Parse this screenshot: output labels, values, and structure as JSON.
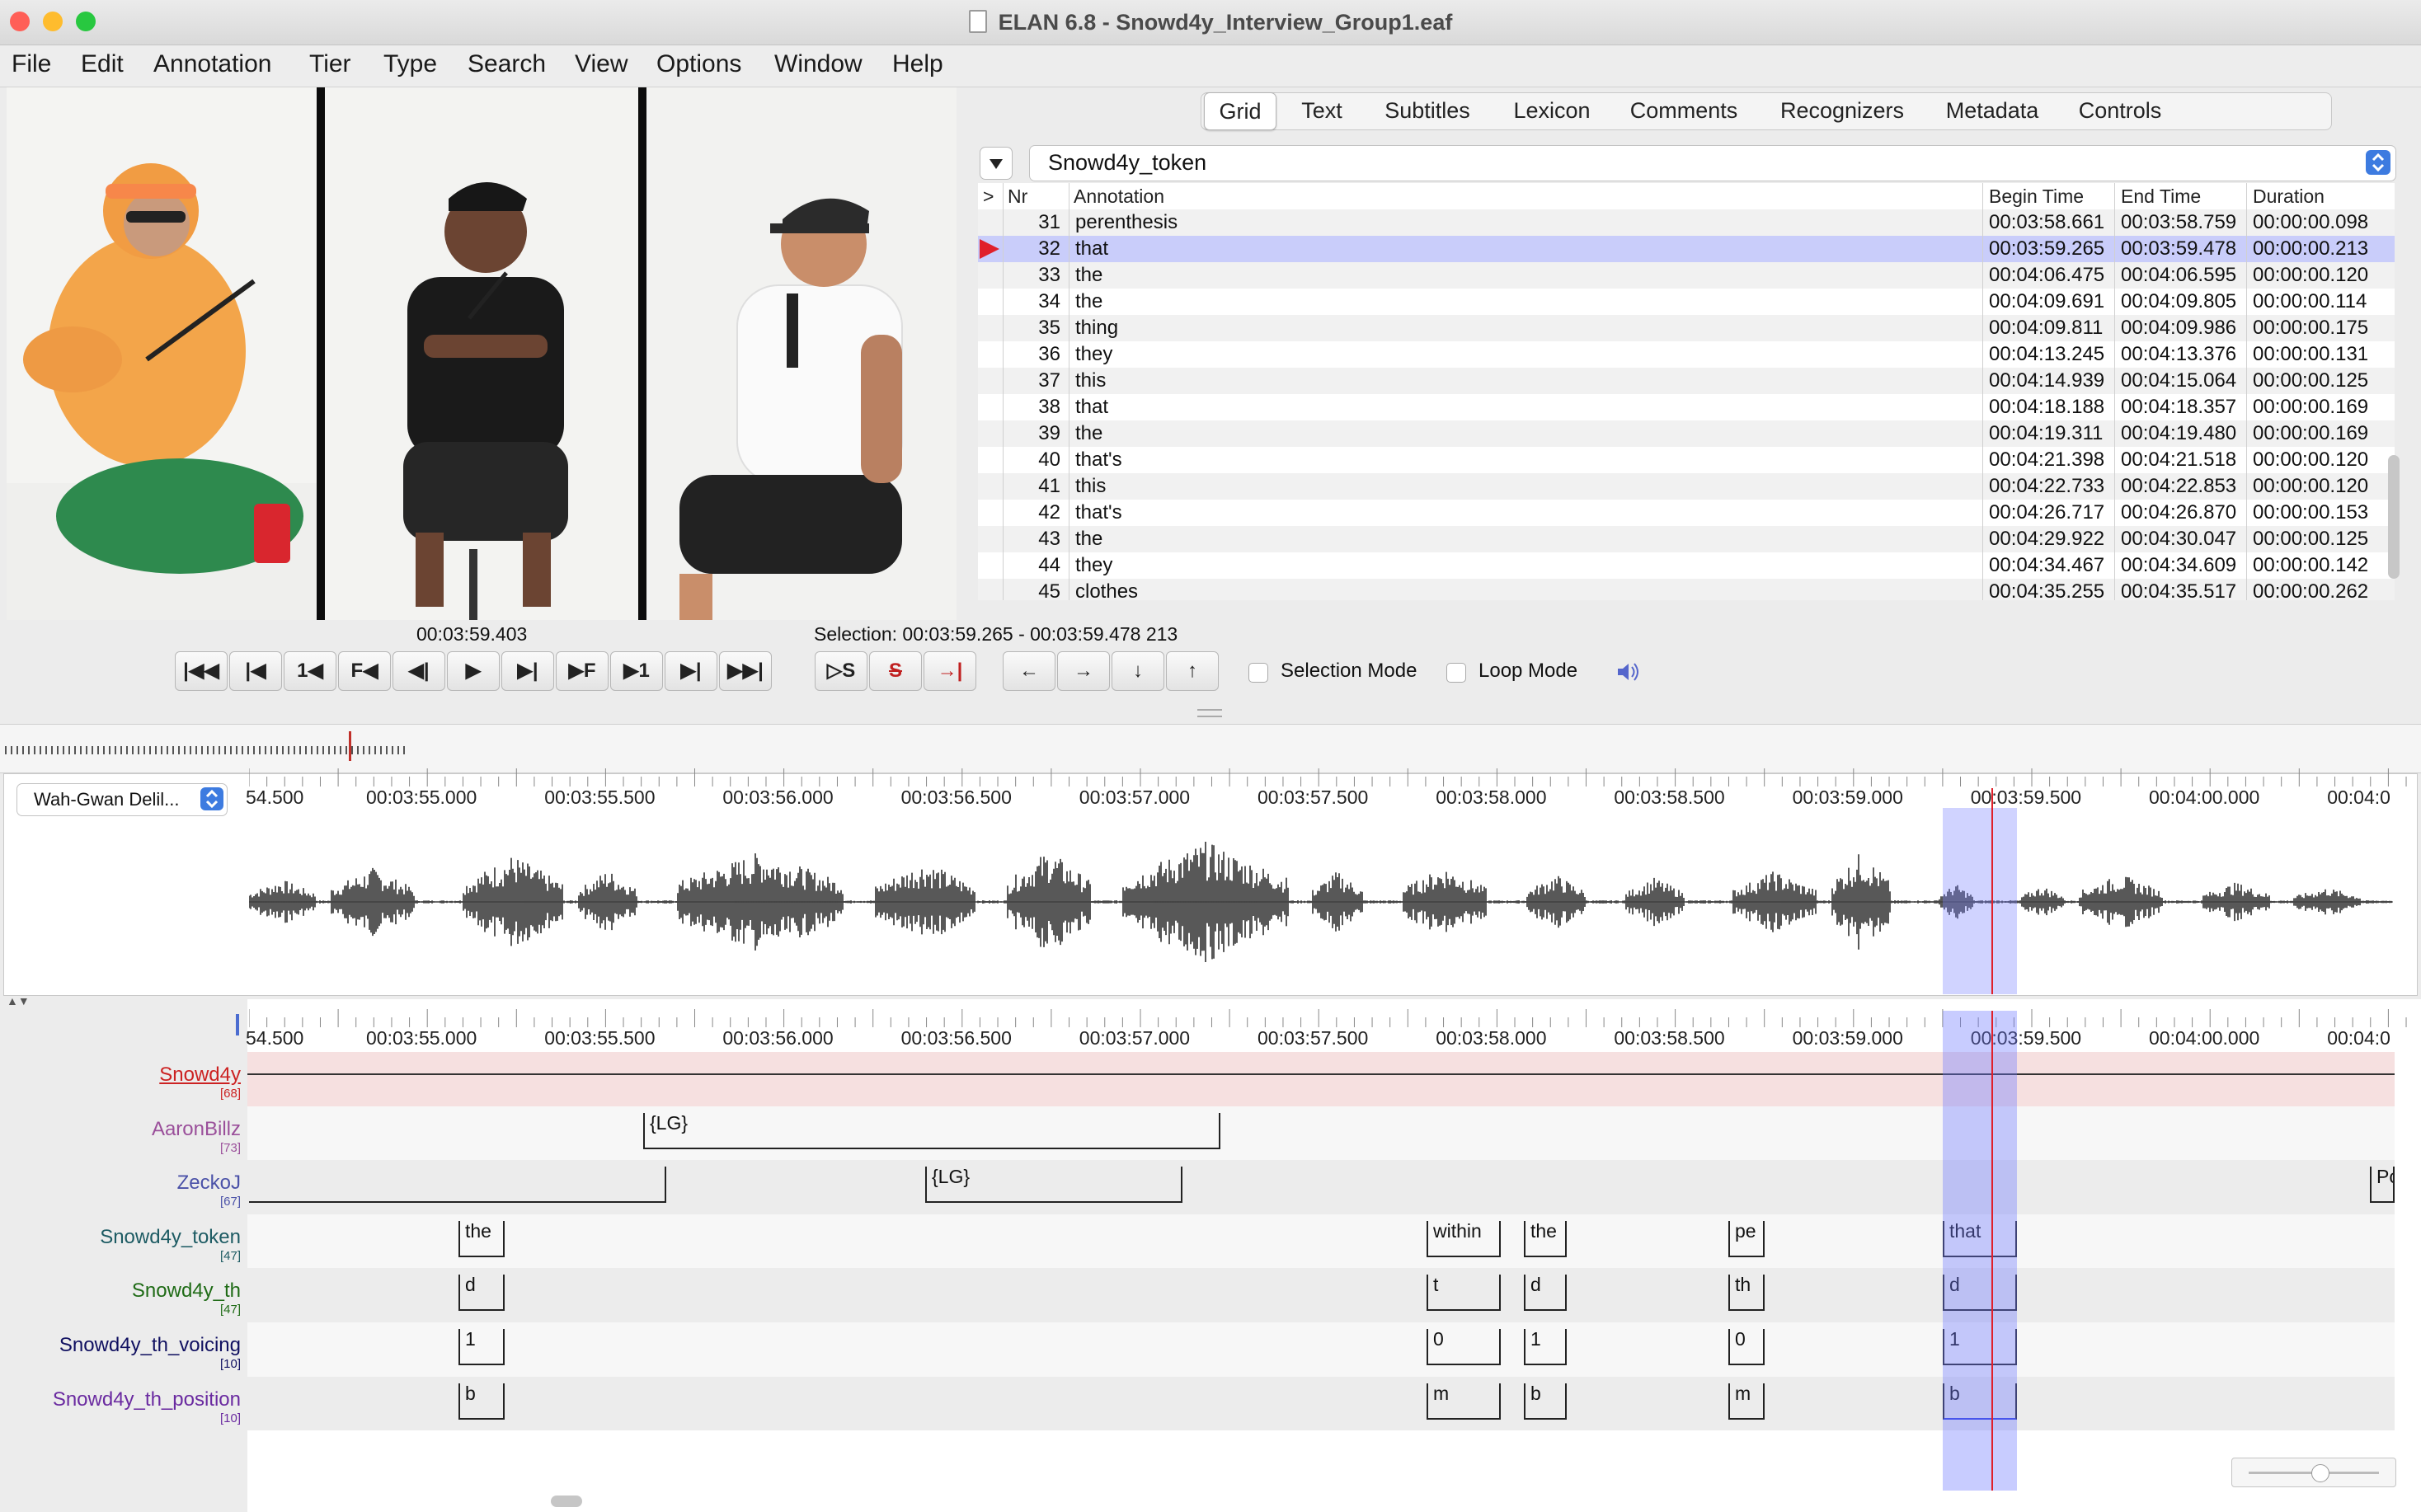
{
  "window": {
    "title": "ELAN 6.8 - Snowd4y_Interview_Group1.eaf",
    "traffic_lights": {
      "close": "#ff5f57",
      "minimize": "#febc2e",
      "zoom": "#28c840"
    }
  },
  "menubar": [
    "File",
    "Edit",
    "Annotation",
    "Tier",
    "Type",
    "Search",
    "View",
    "Options",
    "Window",
    "Help"
  ],
  "tabs": [
    "Grid",
    "Text",
    "Subtitles",
    "Lexicon",
    "Comments",
    "Recognizers",
    "Metadata",
    "Controls"
  ],
  "active_tab": "Grid",
  "grid": {
    "tier_selector": "Snowd4y_token",
    "columns": [
      ">",
      "Nr",
      "Annotation",
      "Begin Time",
      "End Time",
      "Duration"
    ],
    "selected_nr": 32,
    "rows": [
      {
        "nr": "31",
        "annotation": "perenthesis",
        "begin": "00:03:58.661",
        "end": "00:03:58.759",
        "duration": "00:00:00.098"
      },
      {
        "nr": "32",
        "annotation": "that",
        "begin": "00:03:59.265",
        "end": "00:03:59.478",
        "duration": "00:00:00.213"
      },
      {
        "nr": "33",
        "annotation": "the",
        "begin": "00:04:06.475",
        "end": "00:04:06.595",
        "duration": "00:00:00.120"
      },
      {
        "nr": "34",
        "annotation": "the",
        "begin": "00:04:09.691",
        "end": "00:04:09.805",
        "duration": "00:00:00.114"
      },
      {
        "nr": "35",
        "annotation": "thing",
        "begin": "00:04:09.811",
        "end": "00:04:09.986",
        "duration": "00:00:00.175"
      },
      {
        "nr": "36",
        "annotation": "they",
        "begin": "00:04:13.245",
        "end": "00:04:13.376",
        "duration": "00:00:00.131"
      },
      {
        "nr": "37",
        "annotation": "this",
        "begin": "00:04:14.939",
        "end": "00:04:15.064",
        "duration": "00:00:00.125"
      },
      {
        "nr": "38",
        "annotation": "that",
        "begin": "00:04:18.188",
        "end": "00:04:18.357",
        "duration": "00:00:00.169"
      },
      {
        "nr": "39",
        "annotation": "the",
        "begin": "00:04:19.311",
        "end": "00:04:19.480",
        "duration": "00:00:00.169"
      },
      {
        "nr": "40",
        "annotation": "that's",
        "begin": "00:04:21.398",
        "end": "00:04:21.518",
        "duration": "00:00:00.120"
      },
      {
        "nr": "41",
        "annotation": "this",
        "begin": "00:04:22.733",
        "end": "00:04:22.853",
        "duration": "00:00:00.120"
      },
      {
        "nr": "42",
        "annotation": "that's",
        "begin": "00:04:26.717",
        "end": "00:04:26.870",
        "duration": "00:00:00.153"
      },
      {
        "nr": "43",
        "annotation": "the",
        "begin": "00:04:29.922",
        "end": "00:04:30.047",
        "duration": "00:00:00.125"
      },
      {
        "nr": "44",
        "annotation": "they",
        "begin": "00:04:34.467",
        "end": "00:04:34.609",
        "duration": "00:00:00.142"
      },
      {
        "nr": "45",
        "annotation": "clothes",
        "begin": "00:04:35.255",
        "end": "00:04:35.517",
        "duration": "00:00:00.262"
      }
    ]
  },
  "media_time": "00:03:59.403",
  "selection_text": "Selection: 00:03:59.265 - 00:03:59.478  213",
  "controls": {
    "player_buttons": [
      "|◀◀",
      "|◀",
      "1◀",
      "F◀",
      "◀|",
      "▶",
      "▶|",
      "▶F",
      "▶1",
      "▶|",
      "▶▶|"
    ],
    "selection_buttons": [
      "▷S",
      "S",
      "→|"
    ],
    "navigation_buttons": [
      "←",
      "→",
      "↓",
      "↑"
    ],
    "selection_mode": "Selection Mode",
    "loop_mode": "Loop Mode",
    "selection_mode_checked": false,
    "loop_mode_checked": false
  },
  "waveform": {
    "media_selector": "Wah-Gwan Delil...",
    "ruler_labels": [
      "54.500",
      "00:03:55.000",
      "00:03:55.500",
      "00:03:56.000",
      "00:03:56.500",
      "00:03:57.000",
      "00:03:57.500",
      "00:03:58.000",
      "00:03:58.500",
      "00:03:59.000",
      "00:03:59.500",
      "00:04:00.000",
      "00:04:0"
    ]
  },
  "timeline": {
    "ruler_labels": [
      "54.500",
      "00:03:55.000",
      "00:03:55.500",
      "00:03:56.000",
      "00:03:56.500",
      "00:03:57.000",
      "00:03:57.500",
      "00:03:58.000",
      "00:03:58.500",
      "00:03:59.000",
      "00:03:59.500",
      "00:04:00.000",
      "00:04:0"
    ],
    "tiers": [
      {
        "name": "Snowd4y",
        "count": "[68]",
        "color": "#cc2222",
        "annotations": []
      },
      {
        "name": "AaronBillz",
        "count": "[73]",
        "color": "#9a4f9a",
        "annotations": [
          {
            "label": "{LG}"
          }
        ]
      },
      {
        "name": "ZeckoJ",
        "count": "[67]",
        "color": "#4b52a8",
        "annotations": [
          {
            "label": ""
          },
          {
            "label": "{LG}"
          },
          {
            "label": "Pc"
          }
        ]
      },
      {
        "name": "Snowd4y_token",
        "count": "[47]",
        "color": "#1d5b63",
        "annotations": [
          {
            "label": "the"
          },
          {
            "label": "within"
          },
          {
            "label": "the"
          },
          {
            "label": "pe"
          },
          {
            "label": "that"
          }
        ]
      },
      {
        "name": "Snowd4y_th",
        "count": "[47]",
        "color": "#1f6b16",
        "annotations": [
          {
            "label": "d"
          },
          {
            "label": "t"
          },
          {
            "label": "d"
          },
          {
            "label": "th"
          },
          {
            "label": "d"
          }
        ]
      },
      {
        "name": "Snowd4y_th_voicing",
        "count": "[10]",
        "color": "#101060",
        "annotations": [
          {
            "label": "1"
          },
          {
            "label": "0"
          },
          {
            "label": "1"
          },
          {
            "label": "0"
          },
          {
            "label": "1"
          }
        ]
      },
      {
        "name": "Snowd4y_th_position",
        "count": "[10]",
        "color": "#6a2aa0",
        "annotations": [
          {
            "label": "b"
          },
          {
            "label": "m"
          },
          {
            "label": "b"
          },
          {
            "label": "m"
          },
          {
            "label": "b"
          }
        ]
      }
    ]
  }
}
